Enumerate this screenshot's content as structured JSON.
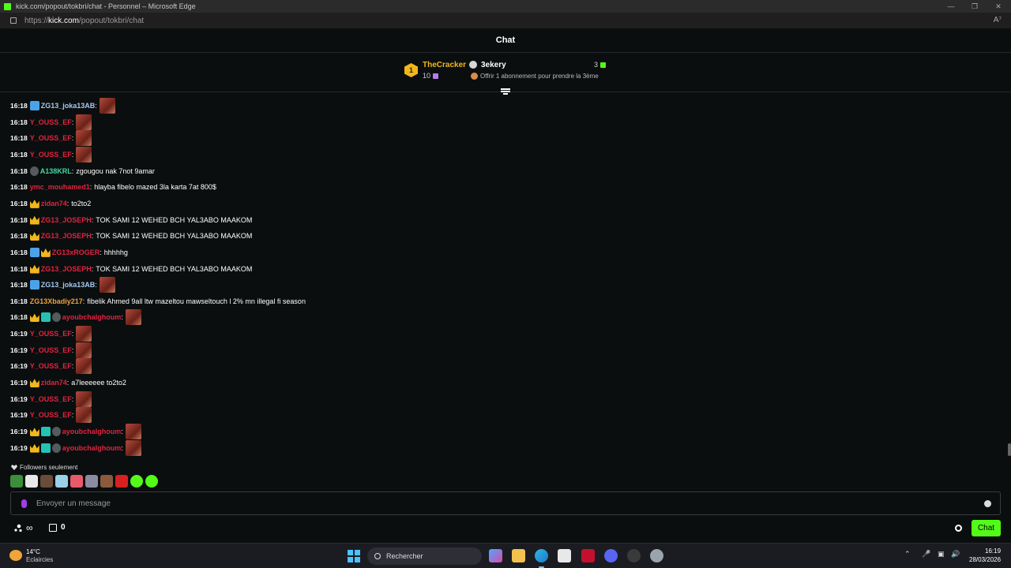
{
  "window": {
    "title": "kick.com/popout/tokbri/chat - Personnel – Microsoft Edge",
    "url_prefix": "https://",
    "url_host": "kick.com",
    "url_path": "/popout/tokbri/chat",
    "controls": [
      "—",
      "❐",
      "✕"
    ]
  },
  "chat_header": {
    "title": "Chat"
  },
  "pinned_gifters": {
    "first": {
      "rank": "1",
      "name": "TheCracker",
      "count": "10"
    },
    "second": {
      "name": "3ekery",
      "count": "3"
    },
    "offer": "Offrir 1 abonnement pour prendre la 3ème"
  },
  "messages": [
    {
      "time": "16:18",
      "badges": [
        "bolt"
      ],
      "user": "ZG13_joka13AB",
      "color": "#a7c8f0",
      "emote": true
    },
    {
      "time": "16:18",
      "badges": [],
      "user": "Y_OUSS_EF",
      "color": "#e0243f",
      "emote": true
    },
    {
      "time": "16:18",
      "badges": [],
      "user": "Y_OUSS_EF",
      "color": "#e0243f",
      "emote": true
    },
    {
      "time": "16:18",
      "badges": [],
      "user": "Y_OUSS_EF",
      "color": "#e0243f",
      "emote": true
    },
    {
      "time": "16:18",
      "badges": [
        "figure"
      ],
      "user": "A138KRL",
      "color": "#3fd9a0",
      "text": "zgougou nak 7not 9amar"
    },
    {
      "time": "16:18",
      "badges": [],
      "user": "ymc_mouhamed1",
      "color": "#e0243f",
      "text": "hlayba fibelo mazed 3la karta 7at 800$"
    },
    {
      "time": "16:18",
      "badges": [
        "crown"
      ],
      "user": "zidan74",
      "color": "#e0243f",
      "text": "to2to2"
    },
    {
      "time": "16:18",
      "badges": [
        "crown"
      ],
      "user": "ZG13_JOSEPH",
      "color": "#e0243f",
      "text": "TOK SAMI 12 WEHED BCH YAL3ABO MAAKOM"
    },
    {
      "time": "16:18",
      "badges": [
        "crown"
      ],
      "user": "ZG13_JOSEPH",
      "color": "#e0243f",
      "text": "TOK SAMI 12 WEHED BCH YAL3ABO MAAKOM"
    },
    {
      "time": "16:18",
      "badges": [
        "bolt",
        "crown"
      ],
      "user": "ZG13xROGER",
      "color": "#e0243f",
      "text": "hhhhhg"
    },
    {
      "time": "16:18",
      "badges": [
        "crown"
      ],
      "user": "ZG13_JOSEPH",
      "color": "#e0243f",
      "text": "TOK SAMI 12 WEHED BCH YAL3ABO MAAKOM"
    },
    {
      "time": "16:18",
      "badges": [
        "bolt"
      ],
      "user": "ZG13_joka13AB",
      "color": "#a7c8f0",
      "emote": true
    },
    {
      "time": "16:18",
      "badges": [],
      "user": "ZG13Xbadiy217",
      "color": "#f0a33b",
      "text": "fibelik Ahmed 9all ltw mazeltou mawseltouch l 2% mn illegal fi season"
    },
    {
      "time": "16:18",
      "badges": [
        "crown",
        "og",
        "figure"
      ],
      "user": "ayoubchalghoum",
      "color": "#e0243f",
      "emote": true
    },
    {
      "time": "16:19",
      "badges": [],
      "user": "Y_OUSS_EF",
      "color": "#e0243f",
      "emote": true
    },
    {
      "time": "16:19",
      "badges": [],
      "user": "Y_OUSS_EF",
      "color": "#e0243f",
      "emote": true
    },
    {
      "time": "16:19",
      "badges": [],
      "user": "Y_OUSS_EF",
      "color": "#e0243f",
      "emote": true
    },
    {
      "time": "16:19",
      "badges": [
        "crown"
      ],
      "user": "zidan74",
      "color": "#e0243f",
      "text": "a7leeeeee to2to2"
    },
    {
      "time": "16:19",
      "badges": [],
      "user": "Y_OUSS_EF",
      "color": "#e0243f",
      "emote": true
    },
    {
      "time": "16:19",
      "badges": [],
      "user": "Y_OUSS_EF",
      "color": "#e0243f",
      "emote": true
    },
    {
      "time": "16:19",
      "badges": [
        "crown",
        "og",
        "figure"
      ],
      "user": "ayoubchalghoum",
      "color": "#e0243f",
      "emote": true
    },
    {
      "time": "16:19",
      "badges": [
        "crown",
        "og",
        "figure"
      ],
      "user": "ayoubchalghoum",
      "color": "#e0243f",
      "emote": true
    }
  ],
  "followers_mode": "Followers seulement",
  "emote_bar": [
    "#3c8f3a",
    "#e8e8e8",
    "#6b4b3a",
    "#9ad0e8",
    "#e85a6a",
    "#8a8aa0",
    "#8b5a3c",
    "#d92020",
    "#53fc18",
    "#53fc18"
  ],
  "input": {
    "placeholder": "Envoyer un message"
  },
  "bottom": {
    "points": "0",
    "chat_button": "Chat"
  },
  "taskbar": {
    "weather_temp": "14°C",
    "weather_desc": "Eclaircies",
    "search_label": "Rechercher",
    "time": "16:19",
    "date": "28/03/2026"
  }
}
